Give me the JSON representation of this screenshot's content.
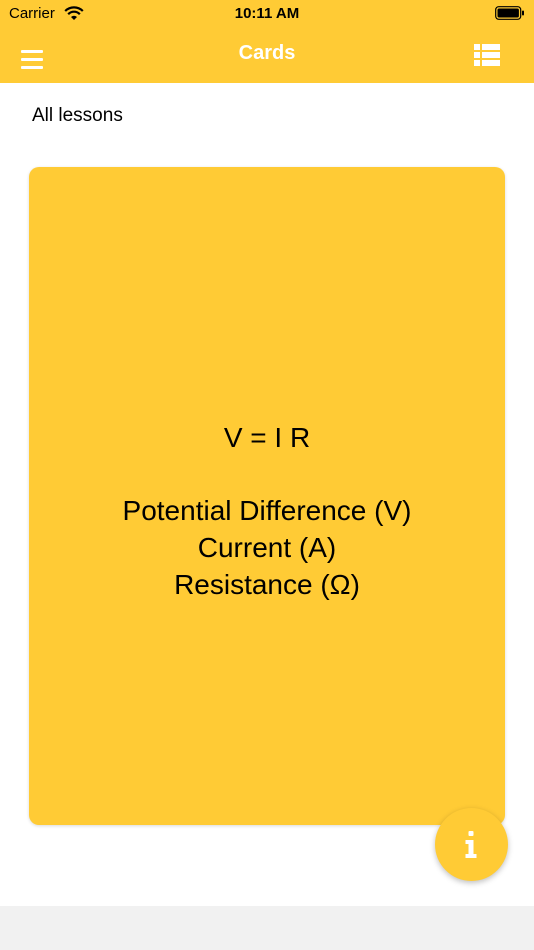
{
  "status_bar": {
    "carrier": "Carrier",
    "time": "10:11 AM"
  },
  "nav": {
    "title": "Cards",
    "left_icon": "hamburger-menu-icon",
    "right_icon": "list-view-icon"
  },
  "subheader": "All lessons",
  "card": {
    "formula": "V = I R",
    "lines": [
      "Potential Difference (V)",
      "Current (A)",
      "Resistance (Ω)"
    ]
  },
  "fab": {
    "icon": "info-icon"
  },
  "colors": {
    "accent": "#FFCB35",
    "nav_text": "#FFFFFF",
    "bottom_bar": "#F1F1F1"
  }
}
